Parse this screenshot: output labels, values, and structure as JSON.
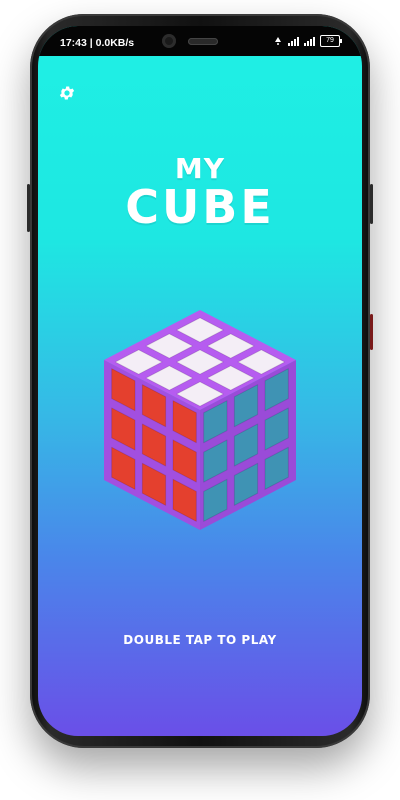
{
  "status_bar": {
    "time_speed": "17:43 | 0.0KB/s",
    "battery": "79"
  },
  "settings": {
    "icon": "gear-icon"
  },
  "title": {
    "line1": "MY",
    "line2": "CUBE"
  },
  "cta": {
    "label": "DOUBLE TAP TO PLAY"
  },
  "colors": {
    "bg_top": "#1ff0e4",
    "bg_bottom": "#6a4fe8",
    "cube_body": "#b65cf0",
    "top_face": "#f4eef6",
    "left_face": "#e4402e",
    "right_face": "#3f93b4"
  }
}
